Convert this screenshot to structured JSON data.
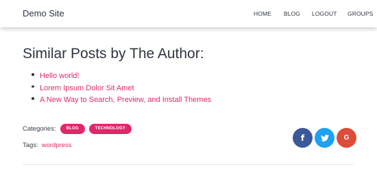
{
  "site": {
    "brand": "Demo Site"
  },
  "nav": {
    "items": [
      {
        "label": "HOME"
      },
      {
        "label": "BLOG"
      },
      {
        "label": "LOGOUT"
      },
      {
        "label": "GROUPS"
      }
    ]
  },
  "section": {
    "title": "Similar Posts by The Author:",
    "posts": [
      {
        "title": "Hello world!"
      },
      {
        "title": "Lorem Ipsum Dolor Sit Amet"
      },
      {
        "title": "A New Way to Search, Preview, and Install Themes"
      }
    ]
  },
  "meta": {
    "categories_label": "Categories:",
    "categories": [
      "BLOG",
      "TECHNOLOGY"
    ],
    "tags_label": "Tags:",
    "tags": [
      "wordpress"
    ]
  },
  "share": {
    "facebook": {
      "icon": "facebook-icon",
      "glyph": "f",
      "color": "#3b5998"
    },
    "twitter": {
      "icon": "twitter-icon",
      "color": "#1da1f2"
    },
    "google": {
      "icon": "google-icon",
      "glyph": "G",
      "color": "#dd4b39"
    }
  },
  "colors": {
    "accent": "#e0276b",
    "text": "#2e3440"
  }
}
